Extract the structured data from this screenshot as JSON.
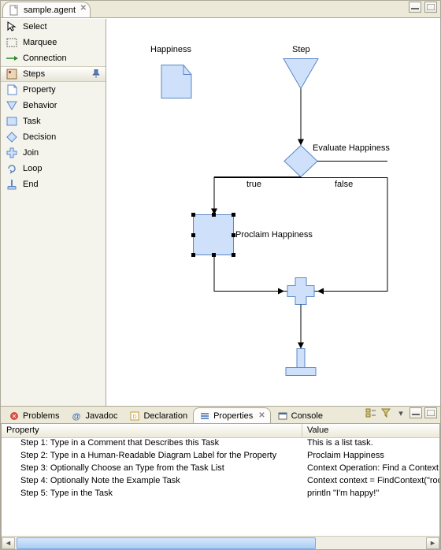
{
  "editor": {
    "tab_title": "sample.agent"
  },
  "palette": {
    "select": "Select",
    "marquee": "Marquee",
    "connection": "Connection",
    "drawer": "Steps",
    "property": "Property",
    "behavior": "Behavior",
    "task": "Task",
    "decision": "Decision",
    "join": "Join",
    "loop": "Loop",
    "end": "End"
  },
  "diagram": {
    "nodes": {
      "happiness": {
        "label": "Happiness"
      },
      "step": {
        "label": "Step"
      },
      "evaluate": {
        "label": "Evaluate Happiness",
        "true_label": "true",
        "false_label": "false"
      },
      "proclaim": {
        "label": "Proclaim Happiness"
      }
    }
  },
  "views": {
    "tabs": {
      "problems": "Problems",
      "javadoc": "Javadoc",
      "declaration": "Declaration",
      "properties": "Properties",
      "console": "Console"
    },
    "columns": {
      "property": "Property",
      "value": "Value"
    },
    "rows": [
      {
        "property": "Step 1: Type in a Comment that Describes this Task",
        "value": "This is a list task."
      },
      {
        "property": "Step 2: Type in a Human-Readable Diagram Label for the Property",
        "value": "Proclaim Happiness"
      },
      {
        "property": "Step 3: Optionally Choose an Type from the Task List",
        "value": "Context Operation: Find a Context [Cont"
      },
      {
        "property": "Step 4: Optionally Note the Example Task",
        "value": "Context context = FindContext(\"root/su"
      },
      {
        "property": "Step 5: Type in the Task",
        "value": "println \"I'm happy!\""
      }
    ]
  }
}
